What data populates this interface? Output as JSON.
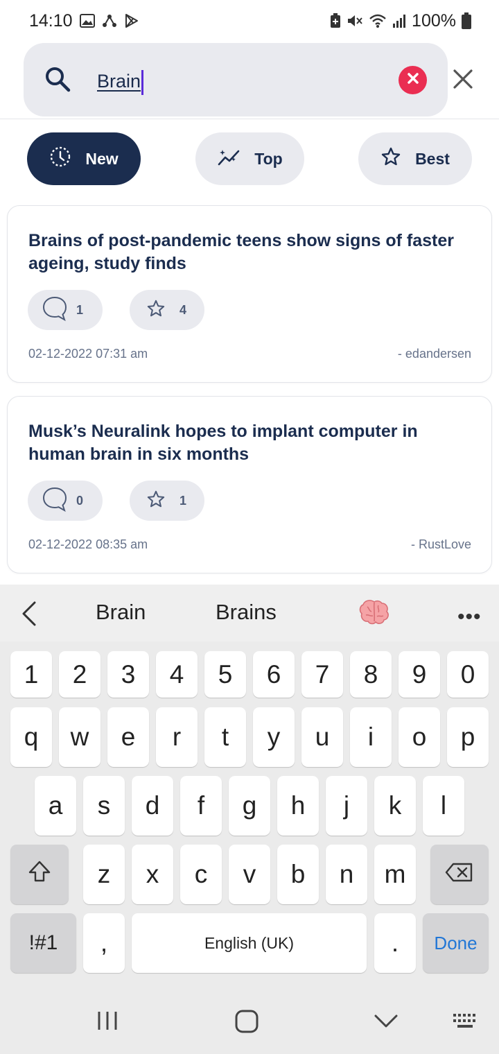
{
  "status_bar": {
    "time": "14:10",
    "battery": "100%",
    "icons_left": [
      "image-icon",
      "share-icon",
      "play-store-icon"
    ],
    "icons_right": [
      "battery-saver-icon",
      "mute-icon",
      "wifi-icon",
      "signal-icon",
      "battery-icon"
    ]
  },
  "search": {
    "query": "Brain",
    "icon": "search-icon",
    "clear_icon": "clear-icon",
    "close_icon": "close-icon"
  },
  "filters": [
    {
      "label": "New",
      "icon": "clock-icon",
      "active": true
    },
    {
      "label": "Top",
      "icon": "trending-icon",
      "active": false
    },
    {
      "label": "Best",
      "icon": "star-icon",
      "active": false
    }
  ],
  "results": [
    {
      "title": "Brains of post-pandemic teens show signs of faster ageing, study finds",
      "comments": "1",
      "stars": "4",
      "date": "02-12-2022 07:31 am",
      "author": "- edandersen"
    },
    {
      "title": "Musk’s Neuralink hopes to implant computer in human brain in six months",
      "comments": "0",
      "stars": "1",
      "date": "02-12-2022 08:35 am",
      "author": "- RustLove"
    }
  ],
  "keyboard": {
    "suggestions": [
      "Brain",
      "Brains"
    ],
    "suggestion_emoji": "brain-emoji-icon",
    "more": "•••",
    "row_numbers": [
      "1",
      "2",
      "3",
      "4",
      "5",
      "6",
      "7",
      "8",
      "9",
      "0"
    ],
    "row_1": [
      "q",
      "w",
      "e",
      "r",
      "t",
      "y",
      "u",
      "i",
      "o",
      "p"
    ],
    "row_2": [
      "a",
      "s",
      "d",
      "f",
      "g",
      "h",
      "j",
      "k",
      "l"
    ],
    "row_3": [
      "z",
      "x",
      "c",
      "v",
      "b",
      "n",
      "m"
    ],
    "symbols_label": "!#1",
    "comma": ",",
    "space_label": "English (UK)",
    "period": ".",
    "done_label": "Done"
  },
  "nav_bar": {
    "items": [
      "recents-icon",
      "home-icon",
      "back-icon",
      "keyboard-icon"
    ]
  },
  "colors": {
    "primary": "#1b2d4f",
    "chip_bg": "#e9eaef",
    "clear_red": "#ea2e52",
    "caret": "#5b2bd9",
    "done_blue": "#2277d6"
  }
}
